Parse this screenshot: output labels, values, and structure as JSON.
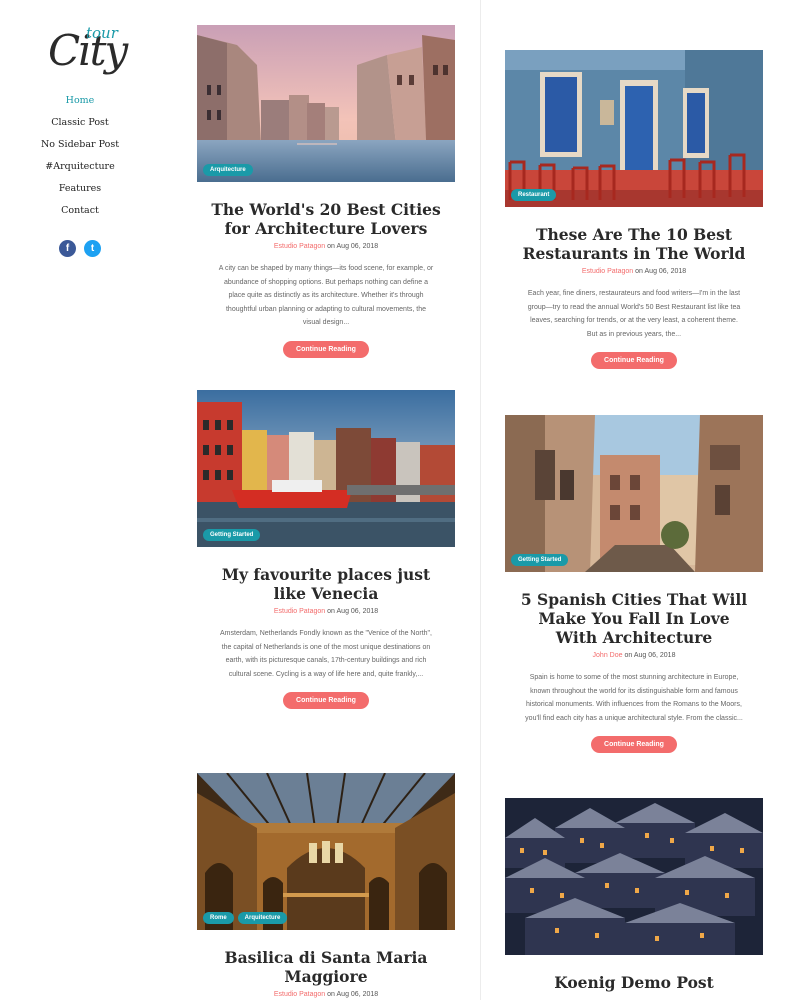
{
  "logo": {
    "main": "City",
    "sub": "tour"
  },
  "nav": [
    {
      "label": "Home",
      "active": true
    },
    {
      "label": "Classic Post",
      "active": false
    },
    {
      "label": "No Sidebar Post",
      "active": false
    },
    {
      "label": "#Arquitecture",
      "active": false
    },
    {
      "label": "Features",
      "active": false
    },
    {
      "label": "Contact",
      "active": false
    }
  ],
  "social": {
    "facebook": "f",
    "twitter": "t"
  },
  "colors": {
    "accent": "#1a9aa8",
    "button": "#f36c6c"
  },
  "posts": [
    {
      "tags": [
        "Arquitecture"
      ],
      "title": "The World's 20 Best Cities for Architecture Lovers",
      "author": "Estudio Patagon",
      "date_prefix": "on",
      "date": "Aug 06, 2018",
      "excerpt": "A city can be shaped by many things—its food scene, for example, or abundance of shopping options. But perhaps nothing can define a place quite as distinctly as its architecture. Whether it's through thoughtful urban planning or adapting to cultural movements, the visual design...",
      "button": "Continue Reading"
    },
    {
      "tags": [
        "Restaurant"
      ],
      "title": "These Are The 10 Best Restaurants in The World",
      "author": "Estudio Patagon",
      "date_prefix": "on",
      "date": "Aug 06, 2018",
      "excerpt": "Each year, fine diners, restaurateurs and food writers—I'm in the last group—try to read the annual World's 50 Best Restaurant list like tea leaves, searching for trends, or at the very least, a coherent theme. But as in previous years, the...",
      "button": "Continue Reading"
    },
    {
      "tags": [
        "Getting Started"
      ],
      "title": "My favourite places just like Venecia",
      "author": "Estudio Patagon",
      "date_prefix": "on",
      "date": "Aug 06, 2018",
      "excerpt": "Amsterdam, Netherlands Fondly known as the \"Venice of the North\", the capital of Netherlands is one of the most unique destinations on earth, with its picturesque canals, 17th-century buildings and rich cultural scene. Cycling is a way of life here and, quite frankly,...",
      "button": "Continue Reading"
    },
    {
      "tags": [
        "Getting Started"
      ],
      "title": "5 Spanish Cities That Will Make You Fall In Love With Architecture",
      "author": "John Doe",
      "date_prefix": "on",
      "date": "Aug 06, 2018",
      "excerpt": "Spain is home to some of the most stunning architecture in Europe, known throughout the world for its distinguishable form and famous historical monuments. With influences from the Romans to the Moors, you'll find each city has a unique architectural style. From the classic...",
      "button": "Continue Reading"
    },
    {
      "tags": [
        "Rome",
        "Arquitecture"
      ],
      "title": "Basilica di Santa Maria Maggiore",
      "author": "Estudio Patagon",
      "date_prefix": "on",
      "date": "Aug 06, 2018"
    },
    {
      "tags": [],
      "title": "Koenig Demo Post"
    }
  ]
}
